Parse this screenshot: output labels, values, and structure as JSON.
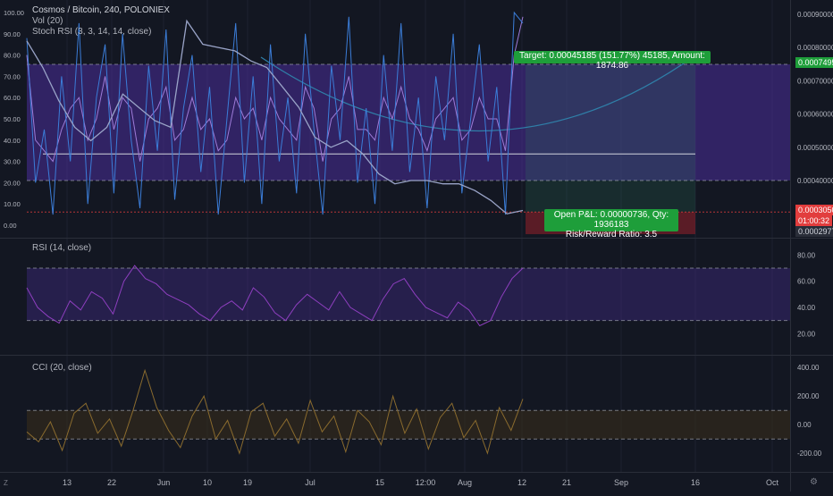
{
  "header": {
    "symbol": "Cosmos / Bitcoin, 240, POLONIEX",
    "vol_label": "Vol (20)",
    "stoch_label": "Stoch RSI (3, 3, 14, 14, close)"
  },
  "panes": {
    "rsi_label": "RSI (14, close)",
    "cci_label": "CCI (20, close)"
  },
  "trade": {
    "target_text": "Target: 0.00045185 (151.77%) 45185, Amount: 1874.86",
    "pnl_line1": "Open P&L: 0.00000736, Qty: 1936183",
    "pnl_line2": "Risk/Reward Ratio: 3.5"
  },
  "price_tags": {
    "target": "0.00074958",
    "current": "0.00030509",
    "timer": "01:00:32",
    "stop": "0.00029773"
  },
  "colors": {
    "background": "#131722",
    "price_line": "#4a5a8a",
    "stoch_k": "#3b7dd8",
    "stoch_d": "#9e7bd8",
    "rsi": "#8e3fbf",
    "cci": "#8a6b2e",
    "profit_zone": "#4a2d9a",
    "loss_zone": "#8a1f2a",
    "target_green": "#1e9e3a",
    "current_red": "#e23d3d"
  },
  "chart_data": [
    {
      "type": "line",
      "name": "main",
      "title": "Cosmos / Bitcoin, 240, POLONIEX",
      "x_ticks": [
        "13",
        "22",
        "Jun",
        "10",
        "19",
        "Jul",
        "15",
        "12:00",
        "Aug",
        "12",
        "21",
        "Sep",
        "16",
        "Oct"
      ],
      "y_ticks_right": [
        "0.00090000",
        "0.00080000",
        "0.00070000",
        "0.00060000",
        "0.00050000",
        "0.00040000"
      ],
      "y_ticks_left": [
        "100.00",
        "90.00",
        "80.00",
        "70.00",
        "60.00",
        "50.00",
        "40.00",
        "30.00",
        "20.00",
        "10.00",
        "0.00"
      ],
      "price_series": [
        0.00082,
        0.00074,
        0.00064,
        0.00056,
        0.00052,
        0.00056,
        0.00066,
        0.00062,
        0.00058,
        0.00056,
        0.00088,
        0.00081,
        0.0008,
        0.00079,
        0.00076,
        0.00074,
        0.00068,
        0.00062,
        0.00053,
        0.0005,
        0.00052,
        0.00048,
        0.00042,
        0.00039,
        0.0004,
        0.0004,
        0.00039,
        0.00039,
        0.00037,
        0.00034,
        0.0003,
        0.00031
      ],
      "stoch_k": [
        88,
        20,
        45,
        5,
        70,
        30,
        95,
        10,
        60,
        85,
        15,
        90,
        40,
        8,
        75,
        35,
        92,
        12,
        55,
        80,
        25,
        65,
        5,
        50,
        95,
        20,
        70,
        10,
        85,
        30,
        60,
        15,
        90,
        45,
        5,
        75,
        40,
        98,
        20,
        55,
        10,
        80,
        35,
        95,
        25,
        60,
        8,
        70,
        40,
        90,
        15,
        50,
        85,
        30,
        65,
        5,
        100,
        95
      ],
      "stoch_d": [
        80,
        40,
        35,
        30,
        45,
        55,
        60,
        40,
        50,
        70,
        45,
        60,
        55,
        30,
        50,
        55,
        65,
        40,
        45,
        60,
        45,
        50,
        35,
        40,
        60,
        50,
        55,
        40,
        60,
        50,
        45,
        40,
        65,
        55,
        30,
        50,
        55,
        70,
        45,
        45,
        40,
        60,
        50,
        65,
        50,
        45,
        35,
        50,
        55,
        60,
        40,
        45,
        60,
        50,
        50,
        35,
        80,
        98
      ],
      "overlay_line_level": 0.00048,
      "target": 0.00074958,
      "entry": 0.00030509,
      "stop": 0.00029773
    },
    {
      "type": "line",
      "name": "rsi",
      "title": "RSI (14, close)",
      "y_ticks": [
        "80.00",
        "60.00",
        "40.00",
        "20.00"
      ],
      "ylim": [
        10,
        85
      ],
      "bands": [
        70,
        30
      ],
      "values": [
        55,
        40,
        33,
        28,
        45,
        38,
        52,
        47,
        35,
        60,
        72,
        62,
        58,
        50,
        46,
        42,
        35,
        30,
        40,
        45,
        38,
        55,
        48,
        36,
        30,
        42,
        50,
        44,
        38,
        52,
        40,
        35,
        30,
        46,
        58,
        62,
        50,
        40,
        36,
        32,
        44,
        38,
        26,
        30,
        48,
        62,
        70
      ]
    },
    {
      "type": "line",
      "name": "cci",
      "title": "CCI (20, close)",
      "y_ticks": [
        "400.00",
        "200.00",
        "0.00",
        "-200.00"
      ],
      "ylim": [
        -280,
        420
      ],
      "bands": [
        100,
        -100
      ],
      "values": [
        -50,
        -120,
        20,
        -180,
        80,
        150,
        -60,
        40,
        -150,
        100,
        380,
        120,
        -40,
        -160,
        60,
        200,
        -100,
        30,
        -200,
        90,
        150,
        -80,
        40,
        -130,
        170,
        -50,
        60,
        -190,
        100,
        20,
        -140,
        200,
        -60,
        110,
        -170,
        50,
        150,
        -90,
        30,
        -200,
        120,
        -40,
        180
      ]
    }
  ]
}
